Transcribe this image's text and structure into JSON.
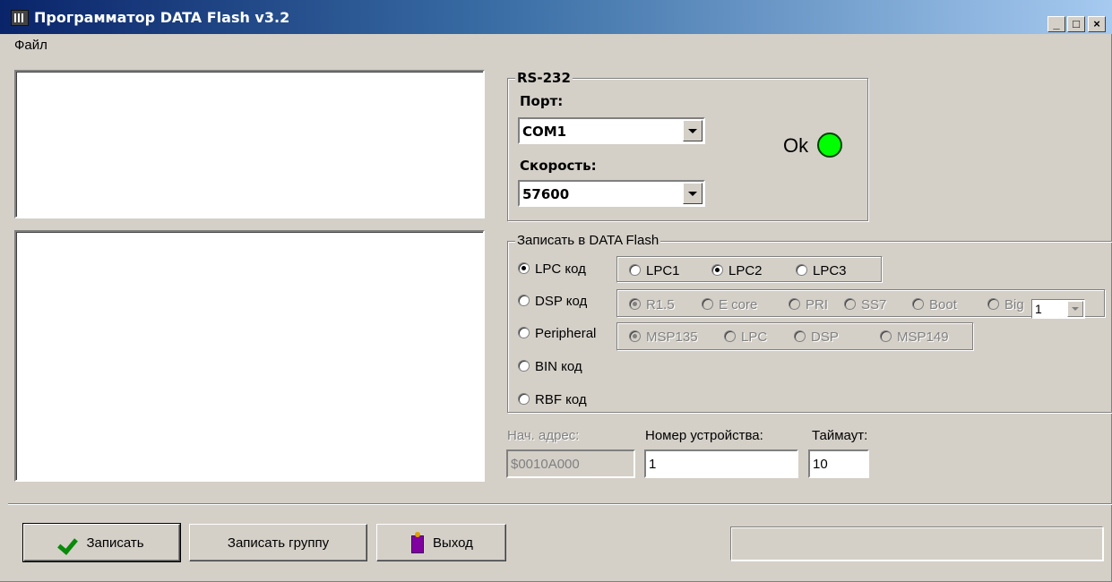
{
  "window": {
    "title": "Программатор DATA Flash v3.2",
    "min_glyph": "_",
    "max_glyph": "□",
    "close_glyph": "×"
  },
  "menu": {
    "file": "Файл"
  },
  "rs232": {
    "group_label": "RS-232",
    "port_label": "Порт:",
    "port_value": "COM1",
    "speed_label": "Скорость:",
    "speed_value": "57600",
    "status_text": "Ok",
    "status_color": "#00ff00"
  },
  "write": {
    "group_label": "Записать в DATA Flash",
    "modes": [
      {
        "label": "LPC код",
        "checked": true
      },
      {
        "label": "DSP код",
        "checked": false
      },
      {
        "label": "Peripheral",
        "checked": false
      },
      {
        "label": "BIN код",
        "checked": false
      },
      {
        "label": "RBF код",
        "checked": false
      }
    ],
    "lpc_options": [
      {
        "label": "LPC1",
        "checked": false
      },
      {
        "label": "LPC2",
        "checked": true
      },
      {
        "label": "LPC3",
        "checked": false
      }
    ],
    "dsp_options": [
      {
        "label": "R1.5",
        "checked": true
      },
      {
        "label": "E core",
        "checked": false
      },
      {
        "label": "PRI",
        "checked": false
      },
      {
        "label": "SS7",
        "checked": false
      },
      {
        "label": "Boot",
        "checked": false
      },
      {
        "label": "Big",
        "checked": false
      }
    ],
    "dsp_number": "1",
    "peripheral_options": [
      {
        "label": "MSP135",
        "checked": true
      },
      {
        "label": "LPC",
        "checked": false
      },
      {
        "label": "DSP",
        "checked": false
      },
      {
        "label": "MSP149",
        "checked": false
      }
    ]
  },
  "fields": {
    "start_address_label": "Нач. адрес:",
    "start_address_value": "$0010A000",
    "device_number_label": "Номер устройства:",
    "device_number_value": "1",
    "timeout_label": "Таймаут:",
    "timeout_value": "10"
  },
  "buttons": {
    "write": "Записать",
    "write_group": "Записать группу",
    "exit": "Выход"
  }
}
